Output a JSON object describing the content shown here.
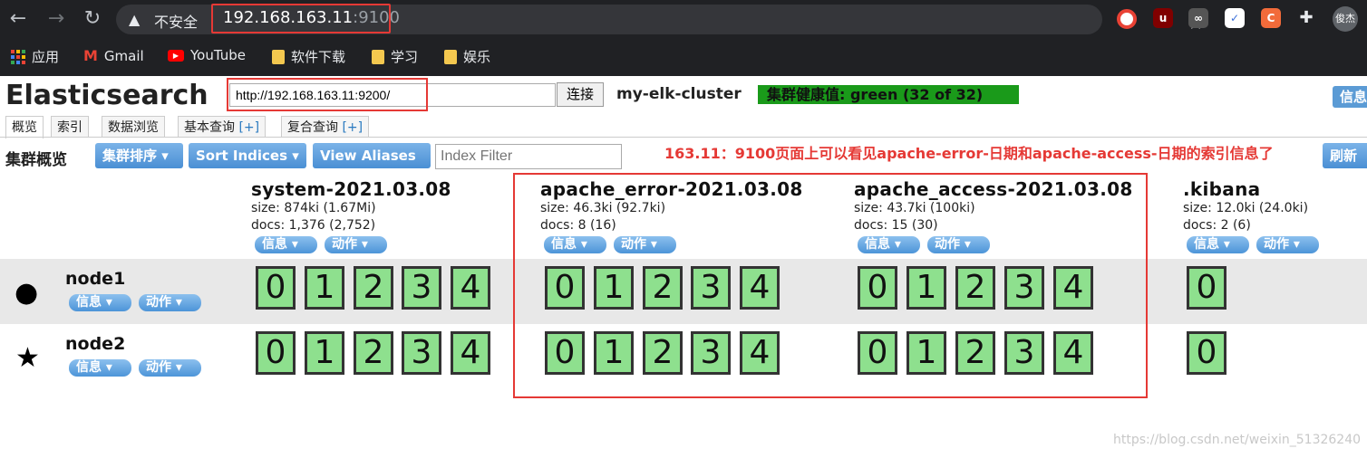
{
  "browser": {
    "url_insecure": "不安全",
    "url_host": "192.168.163.11",
    "url_port": ":9100",
    "avatar": "俊杰",
    "bookmarks": [
      {
        "icon": "apps-icon",
        "label": "应用"
      },
      {
        "icon": "gmail-icon",
        "label": "Gmail"
      },
      {
        "icon": "youtube-icon",
        "label": "YouTube"
      },
      {
        "icon": "folder-icon",
        "label": "软件下载"
      },
      {
        "icon": "folder-icon",
        "label": "学习"
      },
      {
        "icon": "folder-icon",
        "label": "娱乐"
      }
    ]
  },
  "app": {
    "title": "Elasticsearch",
    "connect_url": "http://192.168.163.11:9200/",
    "connect_label": "连接",
    "cluster_name": "my-elk-cluster",
    "health": "集群健康值: green (32 of 32)",
    "info_right": "信息",
    "tabs": [
      {
        "label": "概览",
        "plus": ""
      },
      {
        "label": "索引",
        "plus": ""
      },
      {
        "label": "数据浏览",
        "plus": ""
      },
      {
        "label": "基本查询",
        "plus": "[+]"
      },
      {
        "label": "复合查询",
        "plus": "[+]"
      }
    ],
    "toolbar": {
      "overview_label": "集群概览",
      "sort_cluster": "集群排序",
      "sort_indices": "Sort Indices",
      "view_aliases": "View Aliases",
      "index_filter_placeholder": "Index Filter",
      "refresh": "刷新"
    },
    "annotation": "163.11：9100页面上可以看见apache-error-日期和apache-access-日期的索引信息了",
    "info_pill": "信息",
    "action_pill": "动作"
  },
  "indices": [
    {
      "name": "system-2021.03.08",
      "size": "size: 874ki (1.67Mi)",
      "docs": "docs: 1,376 (2,752)",
      "shards": [
        "0",
        "1",
        "2",
        "3",
        "4"
      ]
    },
    {
      "name": "apache_error-2021.03.08",
      "size": "size: 46.3ki (92.7ki)",
      "docs": "docs: 8 (16)",
      "shards": [
        "0",
        "1",
        "2",
        "3",
        "4"
      ]
    },
    {
      "name": "apache_access-2021.03.08",
      "size": "size: 43.7ki (100ki)",
      "docs": "docs: 15 (30)",
      "shards": [
        "0",
        "1",
        "2",
        "3",
        "4"
      ]
    },
    {
      "name": ".kibana",
      "size": "size: 12.0ki (24.0ki)",
      "docs": "docs: 2 (6)",
      "shards": [
        "0"
      ]
    }
  ],
  "nodes": [
    {
      "name": "node1",
      "icon": "circle-icon",
      "glyph": "●"
    },
    {
      "name": "node2",
      "icon": "star-icon",
      "glyph": "★"
    }
  ],
  "watermark": "https://blog.csdn.net/weixin_51326240"
}
